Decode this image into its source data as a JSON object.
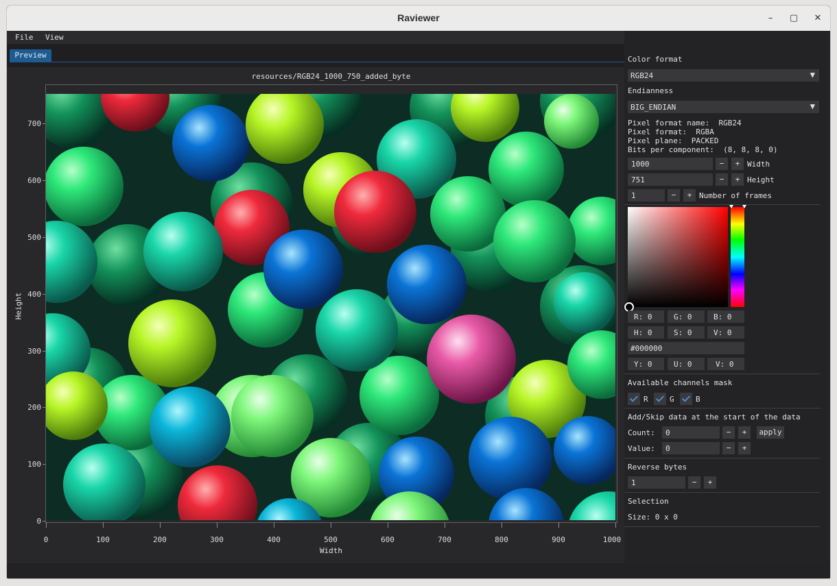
{
  "window": {
    "title": "Raviewer"
  },
  "window_buttons": {
    "minimize": "–",
    "maximize": "▢",
    "close": "✕"
  },
  "menu": {
    "file": "File",
    "view": "View"
  },
  "tabs": {
    "preview": "Preview"
  },
  "plot": {
    "title": "resources/RGB24_1000_750_added_byte",
    "xlabel": "Width",
    "ylabel": "Height",
    "x_ticks": [
      "0",
      "100",
      "200",
      "300",
      "400",
      "500",
      "600",
      "700",
      "800",
      "900",
      "1000"
    ],
    "y_ticks": [
      "700",
      "600",
      "500",
      "400",
      "300",
      "200",
      "100",
      "0"
    ]
  },
  "panel": {
    "color_format_label": "Color format",
    "color_format_value": "RGB24",
    "endianness_label": "Endianness",
    "endianness_value": "BIG_ENDIAN",
    "info": {
      "pixel_format_name": "Pixel format name:  RGB24",
      "pixel_format": "Pixel format:  RGBA",
      "pixel_plane": "Pixel plane:  PACKED",
      "bits_per_component": "Bits per component:  (8, 8, 8, 0)"
    },
    "width": {
      "value": "1000",
      "label": "Width"
    },
    "height": {
      "value": "751",
      "label": "Height"
    },
    "frames": {
      "value": "1",
      "label": "Number of frames"
    },
    "color_picker": {
      "r": "R:  0",
      "g": "G:  0",
      "b": "B:  0",
      "h": "H:  0",
      "s": "S:  0",
      "v": "V:  0",
      "hex": "#000000",
      "y": "Y:  0",
      "u": "U:  0",
      "v2": "V:  0"
    },
    "channels_label": "Available channels mask",
    "channels": {
      "r": "R",
      "g": "G",
      "b": "B"
    },
    "addskip_label": "Add/Skip data at the start of the data",
    "count_label": "Count:",
    "count_value": "0",
    "value_label": "Value:",
    "value_value": "0",
    "apply_label": "apply",
    "reverse_label": "Reverse bytes",
    "reverse_value": "1",
    "selection_label": "Selection",
    "selection_size": "Size: 0 x 0",
    "minus": "−",
    "plus": "+",
    "arrow": "▼"
  }
}
